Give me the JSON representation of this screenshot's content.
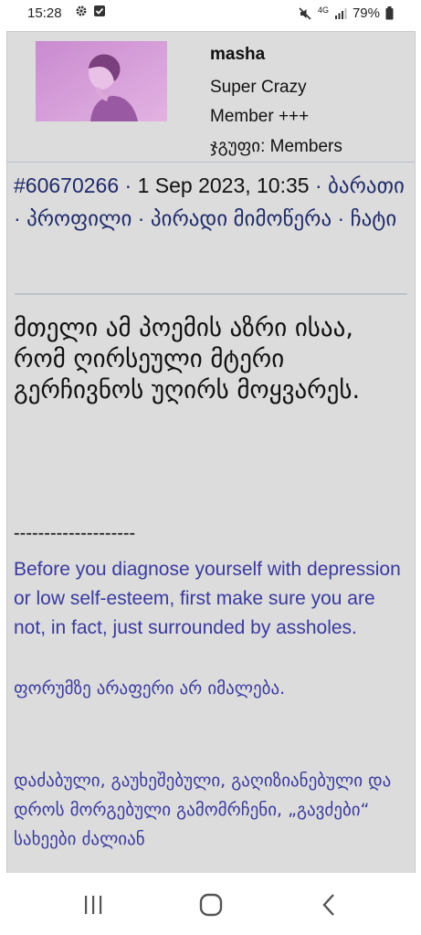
{
  "status": {
    "time": "15:28",
    "network": "4G",
    "battery": "79%"
  },
  "user": {
    "name": "masha",
    "rank_line1": "Super Crazy",
    "rank_line2": "Member +++",
    "group": "ჯგუფი: Members"
  },
  "meta": {
    "post_id": "#60670266",
    "date": "1 Sep 2023, 10:35",
    "link_card": "ბარათი",
    "link_profile": "პროფილი",
    "link_pm": "პირადი მიმოწერა",
    "link_chat": "ჩატი",
    "separator": " · "
  },
  "post": {
    "text": "მთელი ამ პოემის აზრი ისაა, რომ ღირსეული მტერი გერჩივნოს უღირს მოყვარეს."
  },
  "signature": {
    "rule": "--------------------",
    "quote_en": "Before you diagnose yourself with depression or low self-esteem, first make sure you are not, in fact, just surrounded by assholes.",
    "forum_line": "ფორუმზე არაფერი არ იმალება.",
    "words": "დაძაბული, გაუხეშებული, გაღიზიანებული და დროს მორგებული გამომრჩენი, „გავძები“ სახეები ძალიან"
  },
  "colors": {
    "post_bg": "#dcdcdc",
    "link": "#1f2a6a",
    "signature": "#3a3aa0",
    "avatar_tint": "#d79ad6"
  }
}
